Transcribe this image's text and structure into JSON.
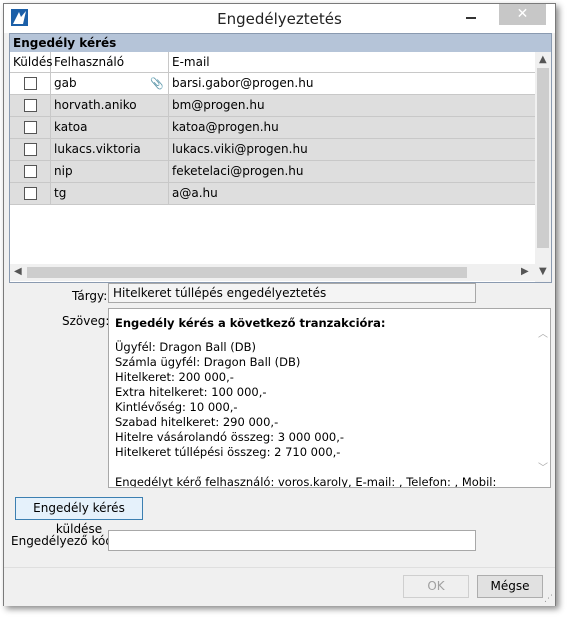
{
  "window": {
    "title": "Engedélyeztetés",
    "close_glyph": "✕"
  },
  "grid": {
    "title": "Engedély kérés",
    "columns": [
      "Küldés",
      "Felhasználó",
      "E-mail"
    ],
    "rows": [
      {
        "user": "gab",
        "email": "barsi.gabor@progen.hu"
      },
      {
        "user": "horvath.aniko",
        "email": "bm@progen.hu"
      },
      {
        "user": "katoa",
        "email": "katoa@progen.hu"
      },
      {
        "user": "lukacs.viktoria",
        "email": "lukacs.viki@progen.hu"
      },
      {
        "user": "nip",
        "email": "feketelaci@progen.hu"
      },
      {
        "user": "tg",
        "email": "a@a.hu"
      }
    ]
  },
  "subject": {
    "label": "Tárgy:",
    "value": "Hitelkeret túllépés engedélyeztetés"
  },
  "body": {
    "label": "Szöveg:",
    "heading": "Engedély kérés a következő tranzakcióra:",
    "lines": [
      "Ügyfél: Dragon Ball (DB)",
      "Számla ügyfél: Dragon Ball (DB)",
      "Hitelkeret: 200 000,-",
      "Extra hitelkeret: 100 000,-",
      "Kintlévőség: 10 000,-",
      "Szabad hitelkeret: 290 000,-",
      "Hitelre vásárolandó összeg: 3 000 000,-",
      "Hitelkeret túllépési összeg: 2 710 000,-",
      "",
      "Engedélyt kérő felhasználó: voros.karoly, E-mail: , Telefon: , Mobil:"
    ]
  },
  "send_button": "Engedély kérés küldése",
  "code": {
    "label": "Engedélyező kód:",
    "value": ""
  },
  "footer": {
    "ok": "OK",
    "cancel": "Mégse"
  }
}
